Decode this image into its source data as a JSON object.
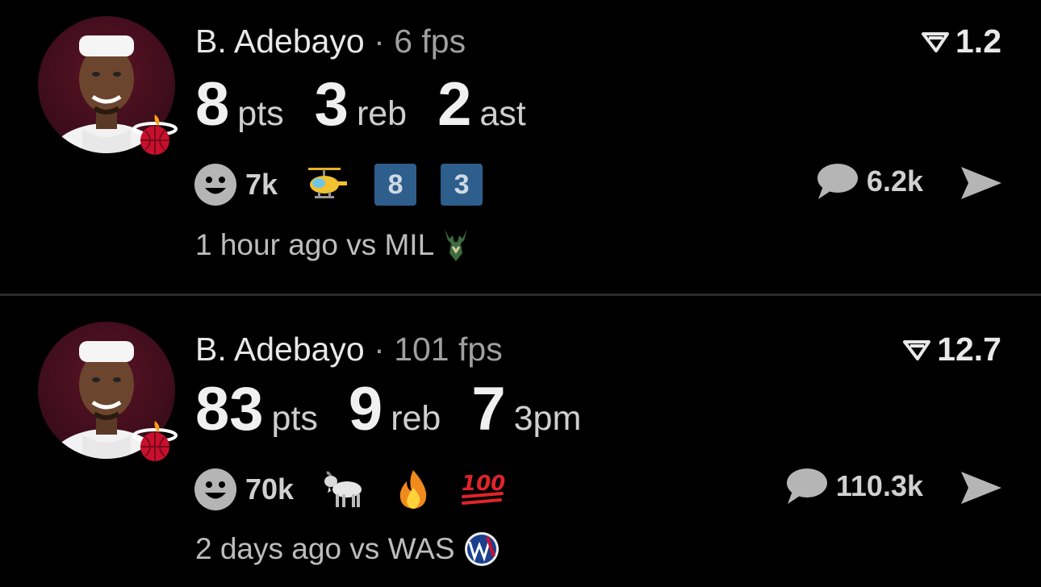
{
  "posts": [
    {
      "player": "B. Adebayo",
      "separator": "·",
      "fps": "6 fps",
      "score": "1.2",
      "stats": [
        {
          "value": "8",
          "unit": "pts"
        },
        {
          "value": "3",
          "unit": "reb"
        },
        {
          "value": "2",
          "unit": "ast"
        }
      ],
      "likes": "7k",
      "badges": [
        "8",
        "3"
      ],
      "comments": "6.2k",
      "time": "1 hour ago vs MIL",
      "icons": [
        "smiley-icon",
        "helicopter-emoji",
        "keycap-8",
        "keycap-3",
        "comment-icon",
        "share-icon",
        "bucks-logo"
      ]
    },
    {
      "player": "B. Adebayo",
      "separator": "·",
      "fps": "101 fps",
      "score": "12.7",
      "stats": [
        {
          "value": "83",
          "unit": "pts"
        },
        {
          "value": "9",
          "unit": "reb"
        },
        {
          "value": "7",
          "unit": "3pm"
        }
      ],
      "likes": "70k",
      "hundred": "100",
      "comments": "110.3k",
      "time": "2 days ago vs WAS",
      "icons": [
        "smiley-icon",
        "goat-emoji",
        "fire-emoji",
        "hundred-emoji",
        "comment-icon",
        "share-icon",
        "wizards-logo"
      ]
    }
  ],
  "colors": {
    "background": "#000000",
    "badge": "#2e5e8c",
    "heat_red": "#c8102e"
  }
}
